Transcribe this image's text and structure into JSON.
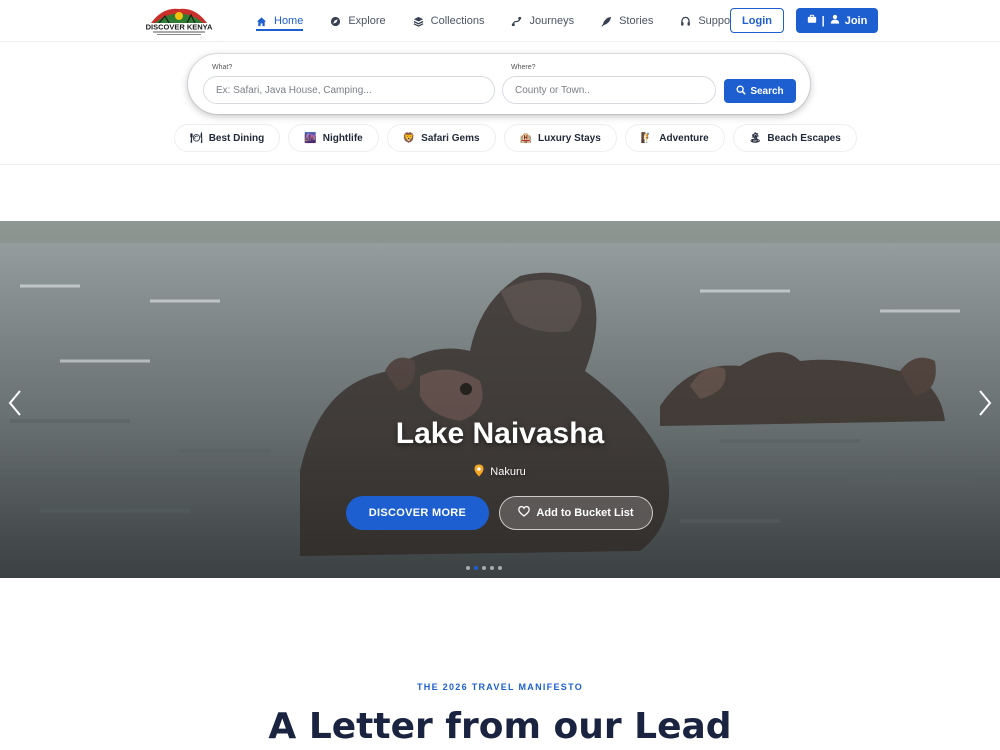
{
  "brand": {
    "name": "DISCOVER KENYA"
  },
  "nav": {
    "links": [
      {
        "label": "Home",
        "icon": "home-icon",
        "active": true
      },
      {
        "label": "Explore",
        "icon": "compass-icon"
      },
      {
        "label": "Collections",
        "icon": "layers-icon"
      },
      {
        "label": "Journeys",
        "icon": "route-icon"
      },
      {
        "label": "Stories",
        "icon": "feather-icon"
      },
      {
        "label": "Support",
        "icon": "headset-icon"
      }
    ],
    "login_label": "Login",
    "join_label": "Join"
  },
  "search": {
    "what_label": "What?",
    "what_placeholder": "Ex: Safari, Java House, Camping...",
    "where_label": "Where?",
    "where_placeholder": "County or Town..",
    "button_label": "Search"
  },
  "categories": [
    {
      "label": "Best Dining",
      "icon": "🍽"
    },
    {
      "label": "Nightlife",
      "icon": "🌆"
    },
    {
      "label": "Safari Gems",
      "icon": "🦁"
    },
    {
      "label": "Luxury Stays",
      "icon": "🏨"
    },
    {
      "label": "Adventure",
      "icon": "🧗"
    },
    {
      "label": "Beach Escapes",
      "icon": "🏝"
    }
  ],
  "hero": {
    "title": "Lake Naivasha",
    "location": "Nakuru",
    "primary_cta": "DISCOVER MORE",
    "secondary_cta": "Add to Bucket List",
    "slide_count": 5,
    "active_slide": 2
  },
  "manifesto": {
    "eyebrow": "THE 2026 TRAVEL MANIFESTO",
    "heading": "A Letter from our Lead"
  },
  "colors": {
    "accent": "#1d5fd1",
    "heading": "#1a2440",
    "pin": "#f5a623"
  }
}
